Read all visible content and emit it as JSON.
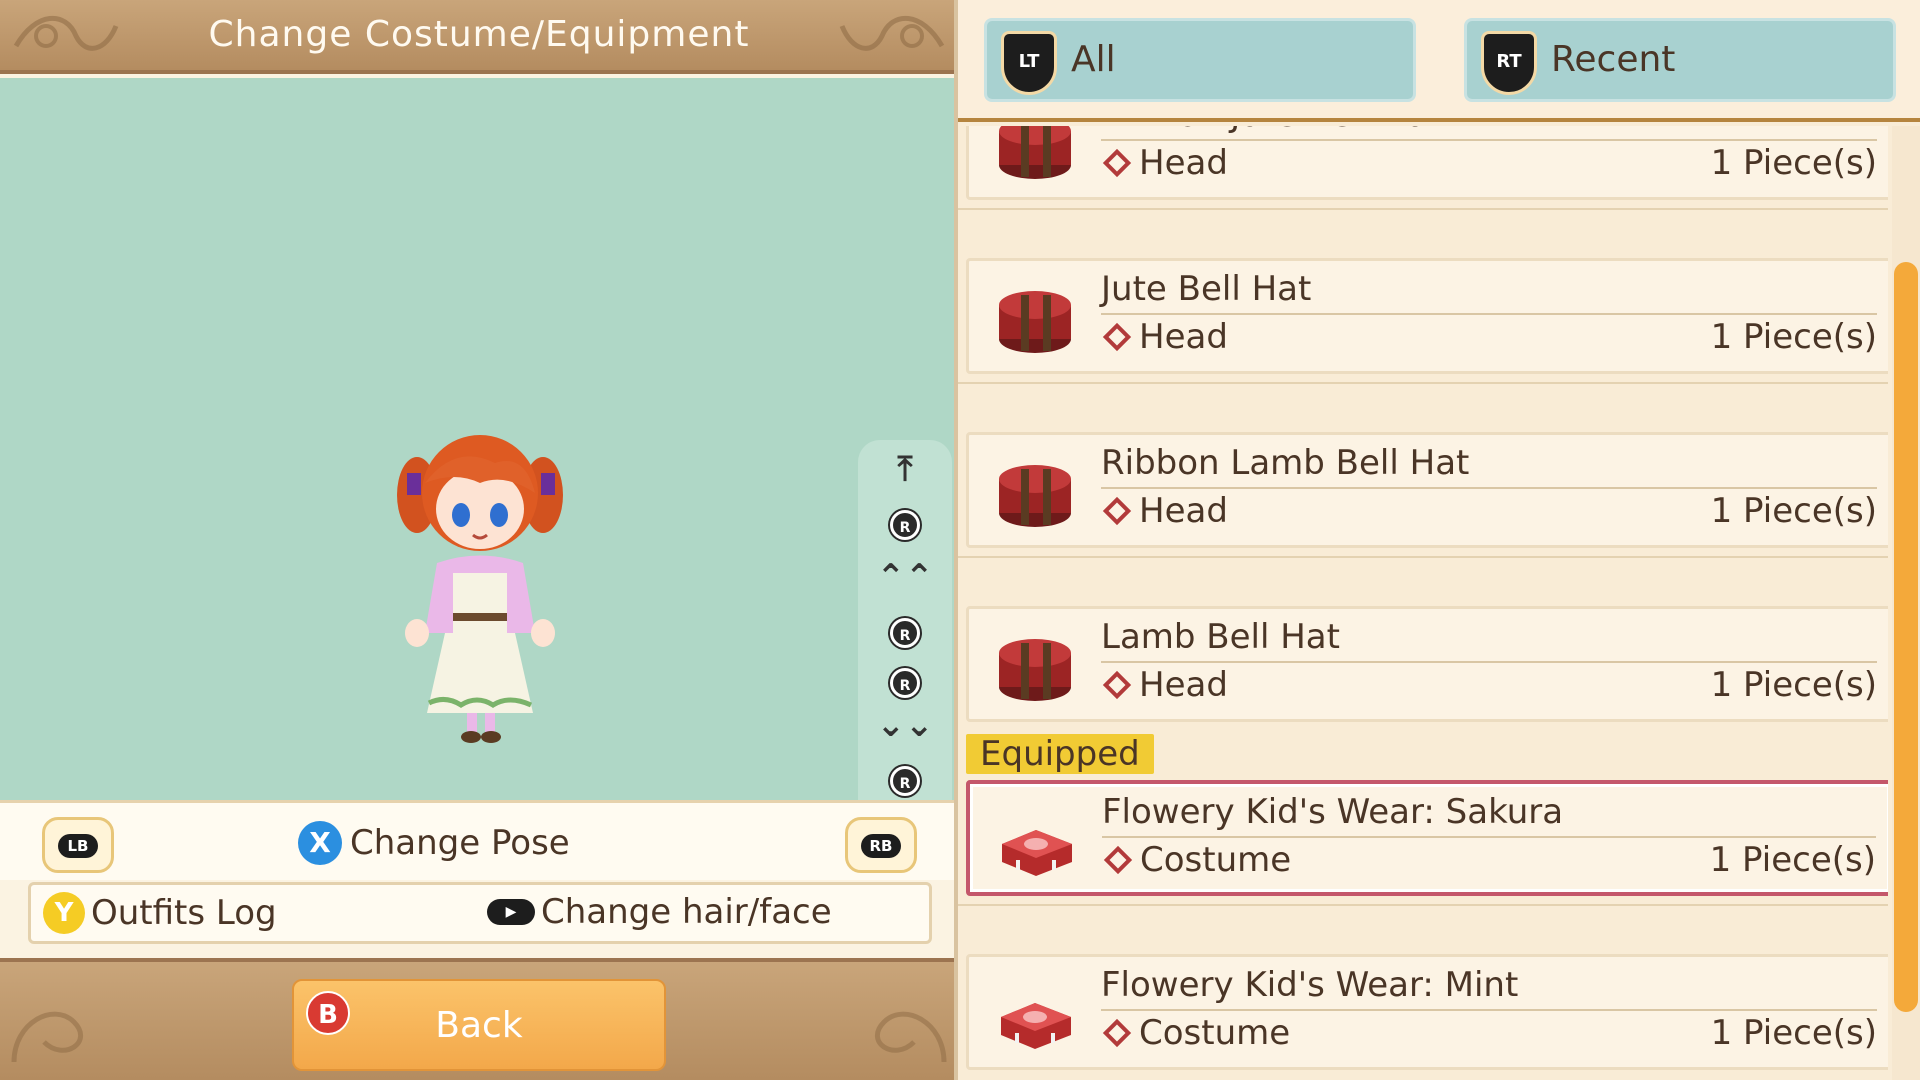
{
  "header": {
    "title": "Change Costume/Equipment"
  },
  "camera": {
    "buttons": [
      "R",
      "R",
      "R",
      "R"
    ],
    "arrows": {
      "top": "⤒",
      "up": "⌃⌃",
      "down": "⌄⌄",
      "bottom": "⤓"
    }
  },
  "controls": {
    "lb_label": "LB",
    "rb_label": "RB",
    "x_label": "X",
    "change_pose": "Change Pose",
    "y_label": "Y",
    "outfits_log": "Outfits Log",
    "change_hair_face": "Change hair/face",
    "b_label": "B",
    "back": "Back"
  },
  "filters": {
    "lt_label": "LT",
    "all": "All",
    "rt_label": "RT",
    "recent": "Recent"
  },
  "list": {
    "equipped_tag": "Equipped",
    "items": [
      {
        "name": "Ribbon Jute Bell Hat",
        "category": "Head",
        "qty": "1 Piece(s)",
        "icon": "hat-box-icon"
      },
      {
        "name": "Jute Bell Hat",
        "category": "Head",
        "qty": "1 Piece(s)",
        "icon": "hat-box-icon"
      },
      {
        "name": "Ribbon Lamb Bell Hat",
        "category": "Head",
        "qty": "1 Piece(s)",
        "icon": "hat-box-icon"
      },
      {
        "name": "Lamb Bell Hat",
        "category": "Head",
        "qty": "1 Piece(s)",
        "icon": "hat-box-icon"
      },
      {
        "name": "Flowery Kid's Wear: Sakura",
        "category": "Costume",
        "qty": "1 Piece(s)",
        "icon": "costume-box-icon",
        "equipped": true
      },
      {
        "name": "Flowery Kid's Wear: Mint",
        "category": "Costume",
        "qty": "1 Piece(s)",
        "icon": "costume-box-icon"
      }
    ]
  },
  "colors": {
    "accent": "#f4a93a",
    "stage": "#afd7c6",
    "equipped_border": "#c4576b"
  }
}
